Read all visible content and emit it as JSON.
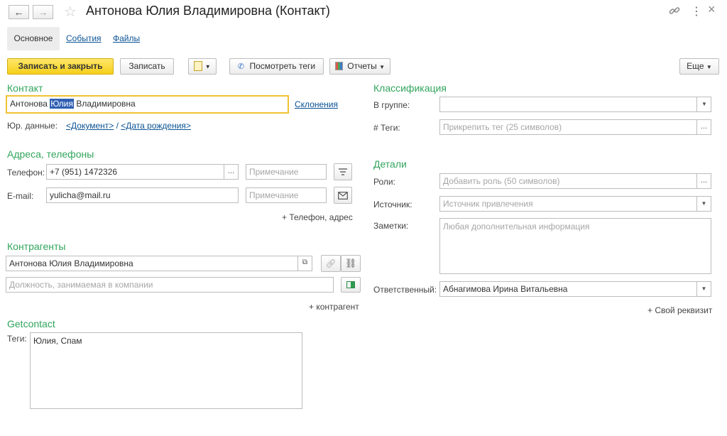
{
  "window": {
    "title": "Антонова Юлия Владимировна (Контакт)",
    "back": "←",
    "forward": "→",
    "more_dots": "⋮",
    "close": "×"
  },
  "tabs": [
    {
      "label": "Основное",
      "active": true
    },
    {
      "label": "События",
      "active": false
    },
    {
      "label": "Файлы",
      "active": false
    }
  ],
  "toolbar": {
    "save_close": "Записать и закрыть",
    "save": "Записать",
    "view_tags": "Посмотреть теги",
    "reports": "Отчеты",
    "more": "Еще"
  },
  "contact": {
    "section": "Контакт",
    "name_before": "Антонова ",
    "name_selected": "Юлия",
    "name_after": " Владимировна",
    "declensions": "Склонения",
    "legal_label": "Юр. данные:",
    "legal_doc": "<Документ>",
    "legal_sep": " / ",
    "legal_birth": "<Дата рождения>"
  },
  "addresses": {
    "section": "Адреса, телефоны",
    "phone_label": "Телефон:",
    "phone_value": "+7 (951) 1472326",
    "phone_note_ph": "Примечание",
    "email_label": "E-mail:",
    "email_value": "yulicha@mail.ru",
    "email_note_ph": "Примечание",
    "add_link": "+ Телефон, адрес"
  },
  "counterparties": {
    "section": "Контрагенты",
    "value": "Антонова Юлия Владимировна",
    "position_ph": "Должность, занимаемая в компании",
    "add_link": "+ контрагент"
  },
  "getcontact": {
    "section": "Getcontact",
    "tags_label": "Теги:",
    "tags_value": "Юлия, Спам"
  },
  "classification": {
    "section": "Классификация",
    "group_label": "В группе:",
    "group_value": "",
    "tags_label": "# Теги:",
    "tags_ph": "Прикрепить тег (25 символов)"
  },
  "details": {
    "section": "Детали",
    "roles_label": "Роли:",
    "roles_ph": "Добавить роль (50 символов)",
    "source_label": "Источник:",
    "source_ph": "Источник привлечения",
    "notes_label": "Заметки:",
    "notes_ph": "Любая дополнительная информация",
    "responsible_label": "Ответственный:",
    "responsible_value": "Абнагимова Ирина Витальевна",
    "add_link": "+ Свой реквизит"
  },
  "colors": {
    "accent_green": "#31a55c",
    "primary_button": "#f5cf1a",
    "link_blue": "#0b5394",
    "focus_yellow": "#f0c234"
  }
}
